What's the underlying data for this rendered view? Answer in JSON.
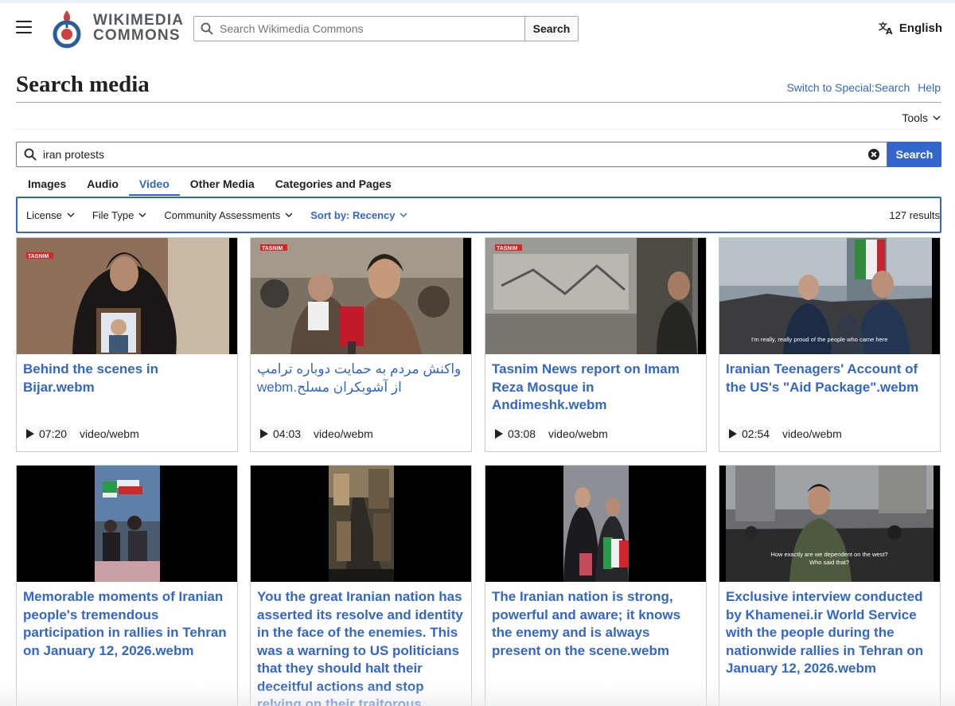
{
  "header": {
    "wordmark_line1": "WIKIMEDIA",
    "wordmark_line2": "COMMONS",
    "search_placeholder": "Search Wikimedia Commons",
    "search_button": "Search",
    "language": "English"
  },
  "page": {
    "title": "Search media",
    "switch_link": "Switch to Special:Search",
    "help_link": "Help",
    "tools": "Tools"
  },
  "search": {
    "query": "iran protests",
    "button": "Search"
  },
  "tabs": [
    {
      "label": "Images",
      "active": false
    },
    {
      "label": "Audio",
      "active": false
    },
    {
      "label": "Video",
      "active": true
    },
    {
      "label": "Other Media",
      "active": false
    },
    {
      "label": "Categories and Pages",
      "active": false
    }
  ],
  "filters": {
    "license": "License",
    "file_type": "File Type",
    "community": "Community Assessments",
    "sort": "Sort by: Recency",
    "results": "127 results"
  },
  "results": [
    {
      "title": "Behind the scenes in Bijar.webm",
      "duration": "07:20",
      "mime": "video/webm"
    },
    {
      "title": "واکنش مردم به حمایت دوباره ترامپ از آشوبکران مسلح.webm",
      "duration": "04:03",
      "mime": "video/webm"
    },
    {
      "title": "Tasnim News report on Imam Reza Mosque in Andimeshk.webm",
      "duration": "03:08",
      "mime": "video/webm"
    },
    {
      "title": "Iranian Teenagers' Account of the US's \"Aid Package\".webm",
      "duration": "02:54",
      "mime": "video/webm"
    },
    {
      "title": "Memorable moments of Iranian people's tremendous participation in rallies in Tehran on January 12, 2026.webm"
    },
    {
      "title": "You the great Iranian nation has asserted its resolve and identity in the face of the enemies. This was a warning to US politicians that they should halt their deceitful actions and stop relying on their traitorous"
    },
    {
      "title": "The Iranian nation is strong, powerful and aware; it knows the enemy and is always present on the scene.webm"
    },
    {
      "title": "Exclusive interview conducted by Khamenei.ir World Service with the people during the nationwide rallies in Tehran on January 12, 2026.webm"
    }
  ],
  "thumbnail_text": {
    "channel_tag": "TASNIM",
    "caption_4": "I'm really, really proud of the people who came here",
    "caption_8_line1": "How exactly are we dependent on the west?",
    "caption_8_line2": "Who said that?"
  },
  "colors": {
    "link": "#3366cc",
    "text": "#202122",
    "border": "#c8ccd1"
  }
}
